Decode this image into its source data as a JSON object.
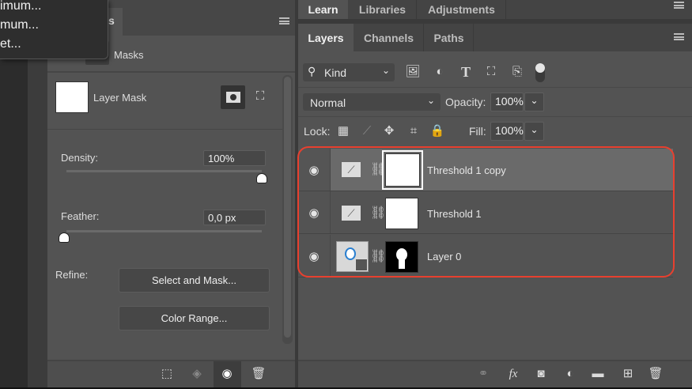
{
  "flyout_menu": {
    "items": [
      "imum...",
      "mum...",
      "et..."
    ]
  },
  "properties": {
    "tab_label": "s",
    "masks_label": "Masks",
    "layer_mask_label": "Layer Mask",
    "density_label": "Density:",
    "density_value": "100%",
    "density_fraction": 1.0,
    "feather_label": "Feather:",
    "feather_value": "0,0 px",
    "feather_fraction": 0.0,
    "refine_label": "Refine:",
    "select_and_mask": "Select and Mask...",
    "color_range": "Color Range..."
  },
  "top_tabs": [
    "Learn",
    "Libraries",
    "Adjustments"
  ],
  "layers_panel": {
    "tabs": [
      "Layers",
      "Channels",
      "Paths"
    ],
    "filter_kind": "Kind",
    "blend_mode": "Normal",
    "opacity_label": "Opacity:",
    "opacity_value": "100%",
    "lock_label": "Lock:",
    "fill_label": "Fill:",
    "fill_value": "100%",
    "layers": [
      {
        "name": "Threshold 1 copy",
        "selected": true
      },
      {
        "name": "Threshold 1",
        "selected": false
      },
      {
        "name": "Layer 0",
        "selected": false
      }
    ]
  },
  "colors": {
    "highlight_outline": "#e8402f",
    "panel": "#535353"
  }
}
